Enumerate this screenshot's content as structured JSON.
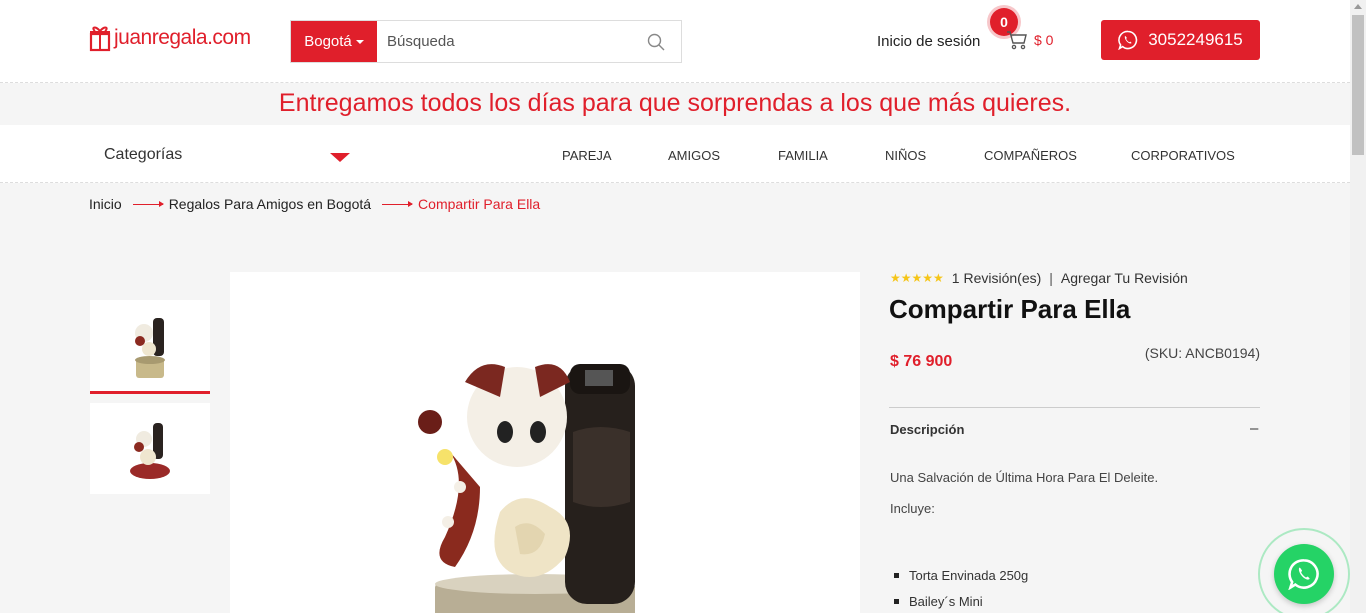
{
  "header": {
    "logo_text": "juanregala.com",
    "city_label": "Bogotá",
    "search_placeholder": "Búsqueda",
    "login_label": "Inicio de sesión",
    "cart_count": "0",
    "cart_amount": "$ 0",
    "whatsapp_number": "3052249615"
  },
  "banner": {
    "text": "Entregamos todos los días para que sorprendas a los que más quieres."
  },
  "nav": {
    "categories_label": "Categorías",
    "items": [
      "PAREJA",
      "AMIGOS",
      "FAMILIA",
      "NIÑOS",
      "COMPAÑEROS",
      "CORPORATIVOS"
    ]
  },
  "breadcrumb": {
    "items": [
      "Inicio",
      "Regalos Para Amigos en Bogotá",
      "Compartir Para Ella"
    ]
  },
  "product": {
    "rating_stars": "★★★★★",
    "reviews_label": "1 Revisión(es)",
    "add_review_label": "Agregar Tu Revisión",
    "title": "Compartir Para Ella",
    "price": "$ 76 900",
    "sku": "(SKU: ANCB0194)",
    "description_label": "Descripción",
    "description_toggle": "–",
    "description_intro": "Una Salvación de Última Hora Para El Deleite.",
    "includes_label": "Incluye:",
    "includes": [
      "Torta Envinada 250g",
      "Bailey´s Mini"
    ]
  },
  "colors": {
    "brand_red": "#e01f2b",
    "whatsapp_green": "#25d366"
  }
}
